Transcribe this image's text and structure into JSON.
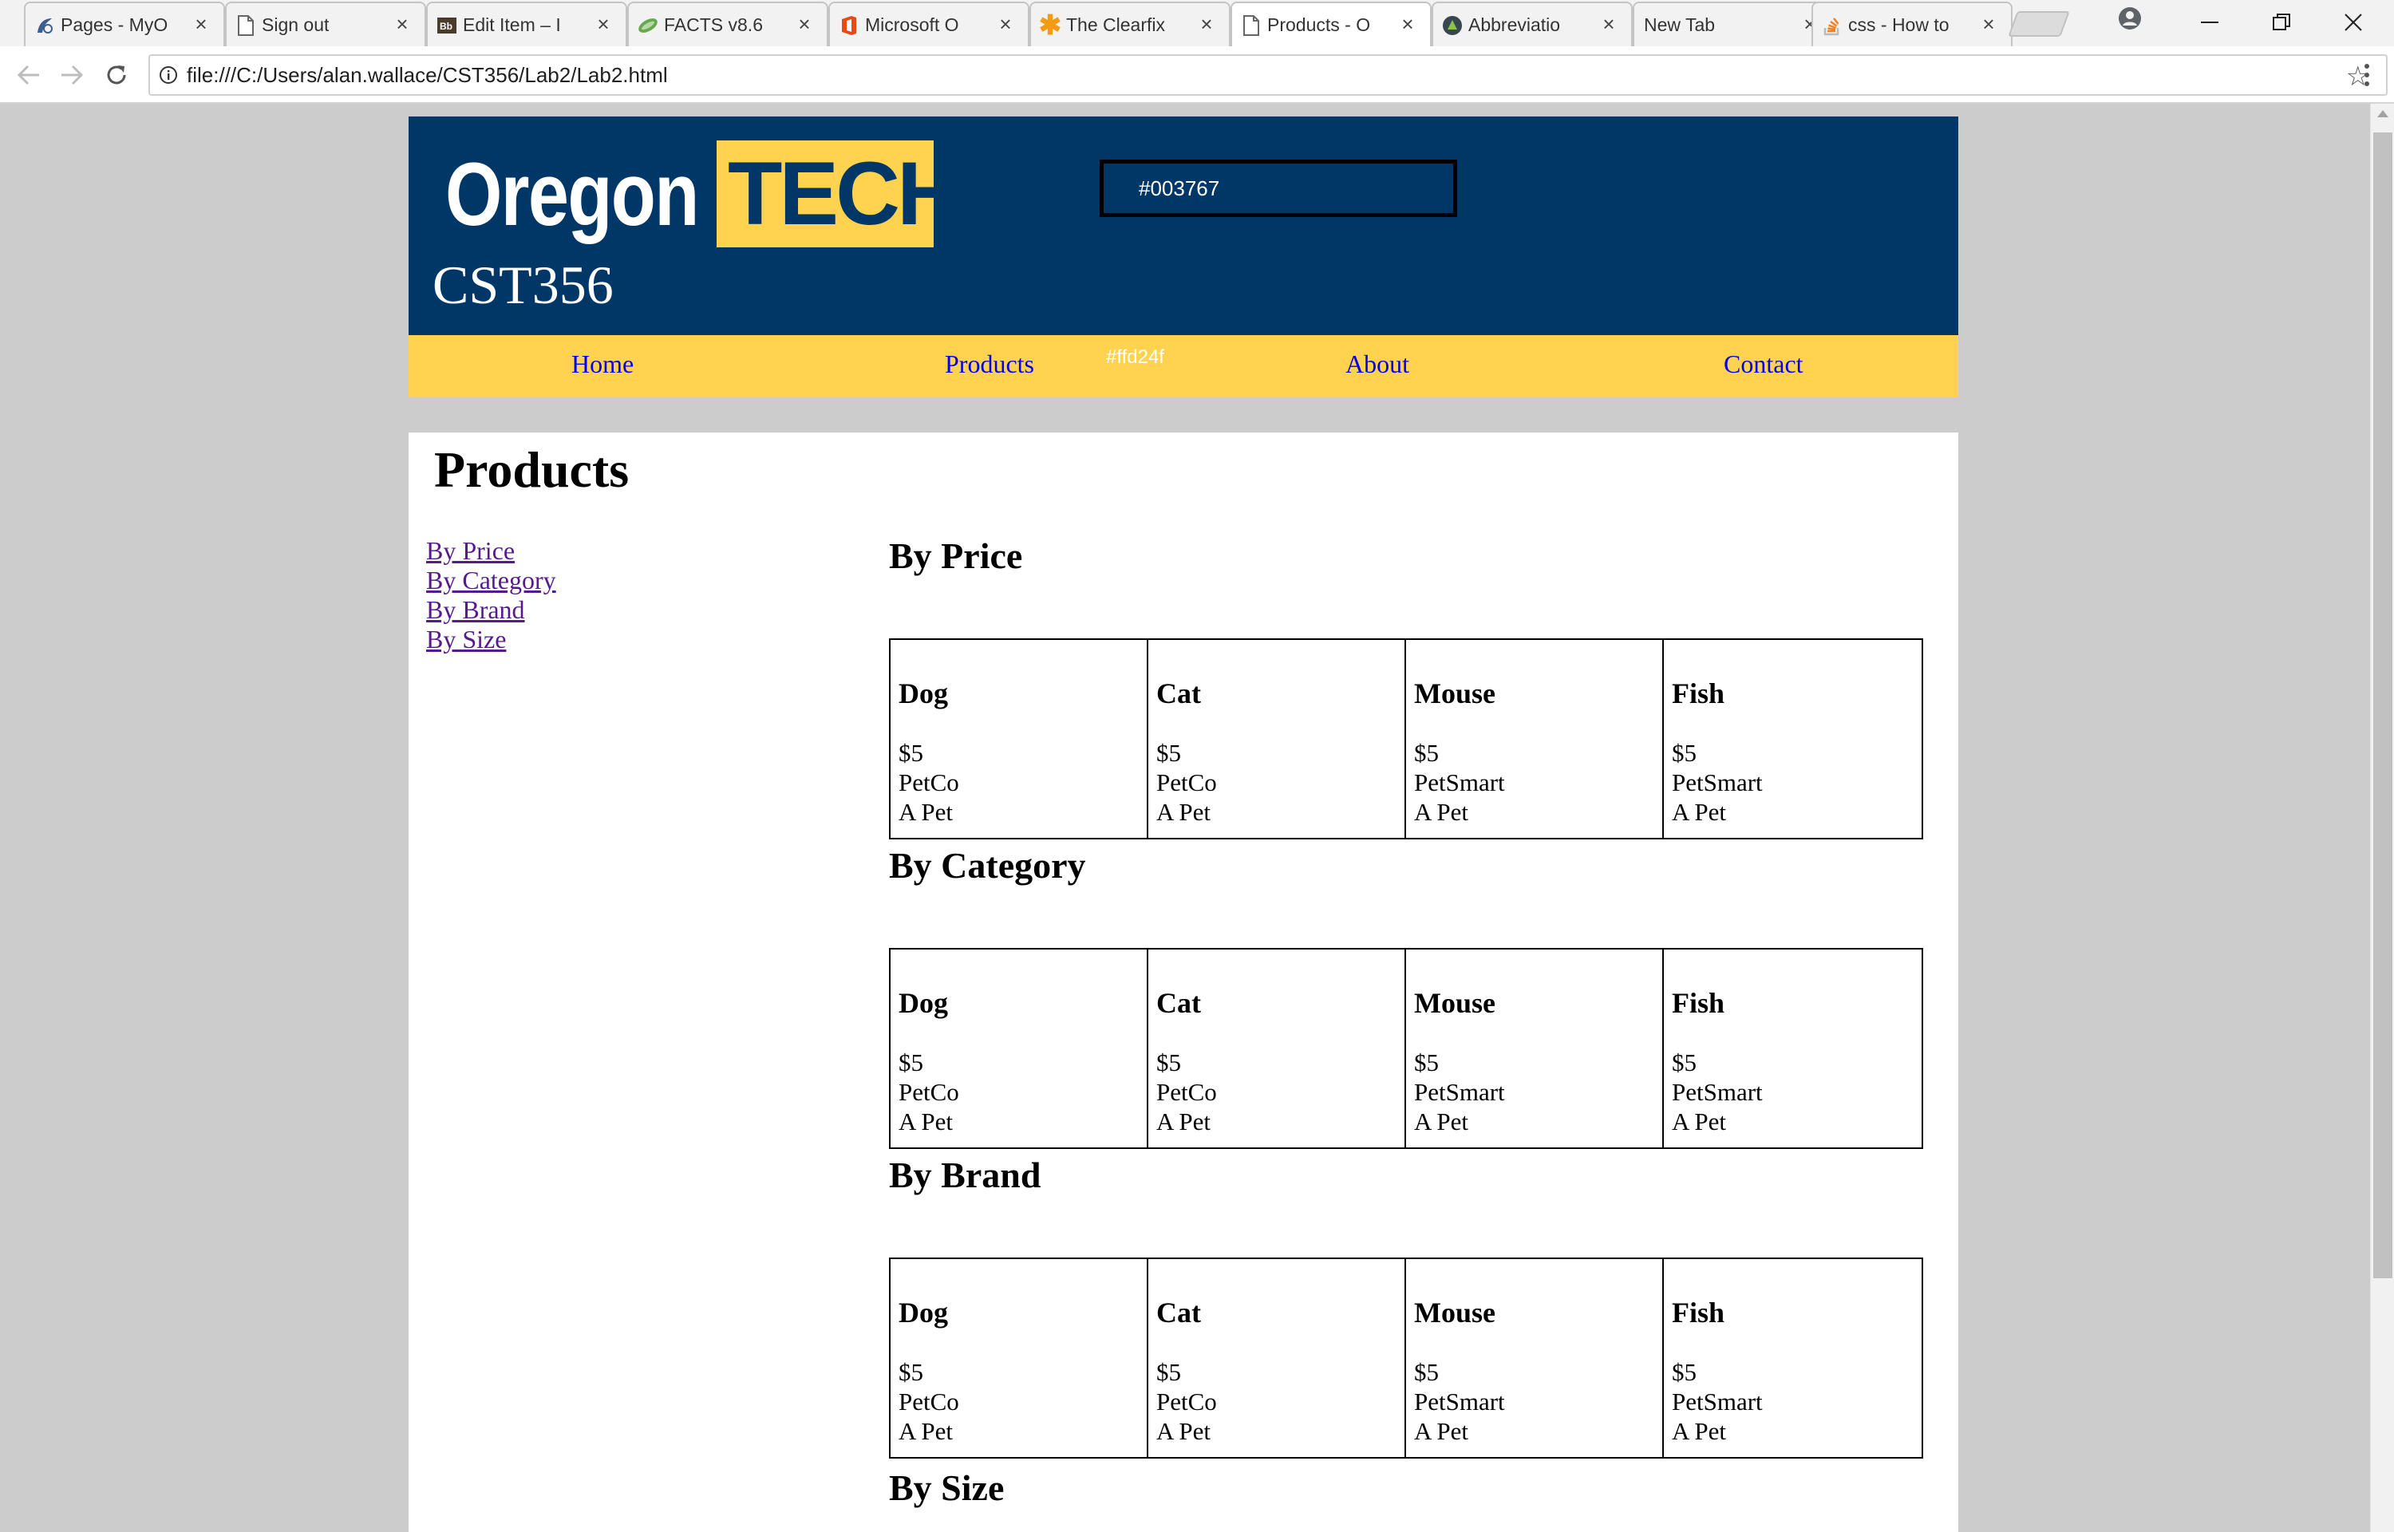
{
  "browser": {
    "tabs": [
      {
        "title": "Pages - MyO",
        "icon": "page-icon",
        "active": false
      },
      {
        "title": "Sign out",
        "icon": "document-icon",
        "active": false
      },
      {
        "title": "Edit Item – I",
        "icon": "edit-icon",
        "active": false
      },
      {
        "title": "FACTS v8.6",
        "icon": "facts-icon",
        "active": false
      },
      {
        "title": "Microsoft O",
        "icon": "office-icon",
        "active": false
      },
      {
        "title": "The Clearfix",
        "icon": "asterisk-icon",
        "active": false
      },
      {
        "title": "Products - O",
        "icon": "document-icon",
        "active": true
      },
      {
        "title": "Abbreviatio",
        "icon": "abbreviation-icon",
        "active": false
      },
      {
        "title": "New Tab",
        "icon": "",
        "active": false
      },
      {
        "title": "css - How to",
        "icon": "stackoverflow-icon",
        "active": false
      }
    ],
    "url": "file:///C:/Users/alan.wallace/CST356/Lab2/Lab2.html"
  },
  "header": {
    "logo_oregon": "Oregon",
    "logo_tech": "TECH",
    "course_code": "CST356",
    "color_box": "#003767",
    "background_color": "#003767"
  },
  "nav": {
    "background_color": "#ffd24f",
    "color_label": "#ffd24f",
    "links": [
      "Home",
      "Products",
      "About",
      "Contact"
    ]
  },
  "main": {
    "title": "Products",
    "side_links": [
      "By Price",
      "By Category",
      "By Brand",
      "By Size"
    ],
    "sections": [
      {
        "title": "By Price",
        "products": [
          {
            "name": "Dog",
            "price": "$5",
            "brand": "PetCo",
            "category": "A Pet"
          },
          {
            "name": "Cat",
            "price": "$5",
            "brand": "PetCo",
            "category": "A Pet"
          },
          {
            "name": "Mouse",
            "price": "$5",
            "brand": "PetSmart",
            "category": "A Pet"
          },
          {
            "name": "Fish",
            "price": "$5",
            "brand": "PetSmart",
            "category": "A Pet"
          }
        ]
      },
      {
        "title": "By Category",
        "products": [
          {
            "name": "Dog",
            "price": "$5",
            "brand": "PetCo",
            "category": "A Pet"
          },
          {
            "name": "Cat",
            "price": "$5",
            "brand": "PetCo",
            "category": "A Pet"
          },
          {
            "name": "Mouse",
            "price": "$5",
            "brand": "PetSmart",
            "category": "A Pet"
          },
          {
            "name": "Fish",
            "price": "$5",
            "brand": "PetSmart",
            "category": "A Pet"
          }
        ]
      },
      {
        "title": "By Brand",
        "products": [
          {
            "name": "Dog",
            "price": "$5",
            "brand": "PetCo",
            "category": "A Pet"
          },
          {
            "name": "Cat",
            "price": "$5",
            "brand": "PetCo",
            "category": "A Pet"
          },
          {
            "name": "Mouse",
            "price": "$5",
            "brand": "PetSmart",
            "category": "A Pet"
          },
          {
            "name": "Fish",
            "price": "$5",
            "brand": "PetSmart",
            "category": "A Pet"
          }
        ]
      },
      {
        "title": "By Size",
        "products": []
      }
    ]
  }
}
